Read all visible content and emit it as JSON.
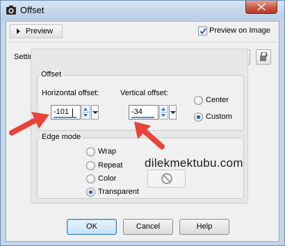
{
  "window": {
    "title": "Offset"
  },
  "toolbar": {
    "preview_label": "Preview",
    "preview_on_image_label": "Preview on Image",
    "preview_on_image_checked": true
  },
  "settings": {
    "label": "Settings",
    "value": ""
  },
  "offset_group": {
    "title": "Offset",
    "horizontal_label": "Horizontal offset:",
    "horizontal_value": "-101",
    "vertical_label": "Vertical offset:",
    "vertical_value": "-34",
    "center_label": "Center",
    "custom_label": "Custom",
    "selected": "Custom"
  },
  "edge_mode": {
    "title": "Edge mode",
    "options": [
      "Wrap",
      "Repeat",
      "Color",
      "Transparent"
    ],
    "selected": "Transparent"
  },
  "watermark": "dilekmektubu.com",
  "buttons": {
    "ok": "OK",
    "cancel": "Cancel",
    "help": "Help"
  },
  "colors": {
    "annotation_arrow": "#e8443a",
    "titlebar": "#c3d5ea",
    "close_button": "#c75844",
    "radio_selected": "#2b63b6"
  }
}
